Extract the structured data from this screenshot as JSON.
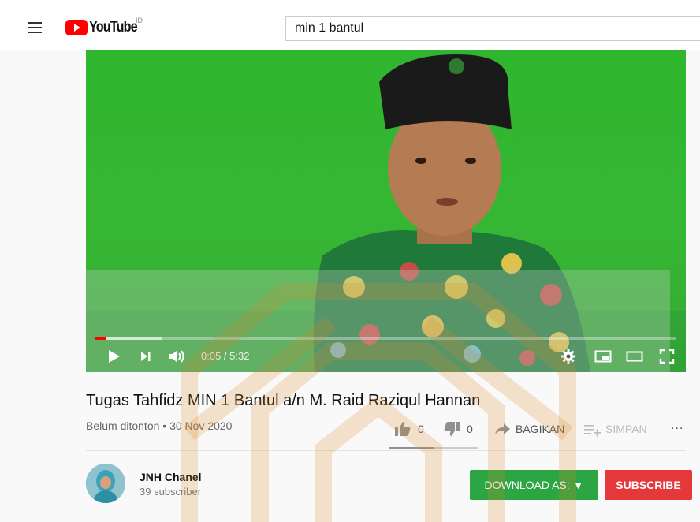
{
  "masthead": {
    "logo_text": "YouTube",
    "logo_country": "ID",
    "search_value": "min 1 bantul"
  },
  "player": {
    "time": "0:05 / 5:32",
    "progress_fraction": 0.015
  },
  "video": {
    "title": "Tugas Tahfidz MIN 1 Bantul a/n M. Raid Raziqul Hannan",
    "meta": "Belum ditonton • 30 Nov 2020",
    "likes": "0",
    "dislikes": "0",
    "share_label": "BAGIKAN",
    "save_label": "SIMPAN",
    "more_label": "..."
  },
  "channel": {
    "name": "JNH Chanel",
    "subscribers": "39 subscriber"
  },
  "buttons": {
    "download": "DOWNLOAD AS: ▼",
    "subscribe": "SUBSCRIBE"
  },
  "colors": {
    "brand_red": "#ff0000",
    "download_green": "#2ca543",
    "subscribe_red": "#e5383b",
    "video_green": "#36b734"
  }
}
